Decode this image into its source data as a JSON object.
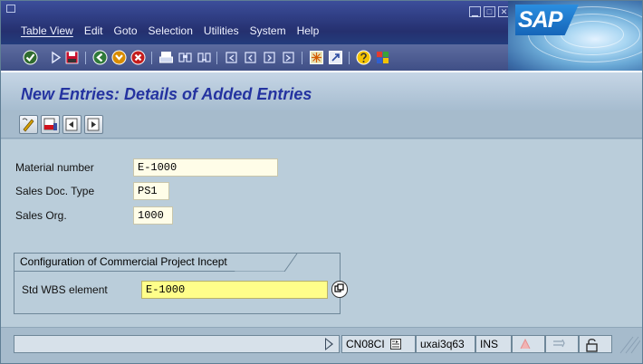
{
  "menu": {
    "items": [
      "Table View",
      "Edit",
      "Goto",
      "Selection",
      "Utilities",
      "System",
      "Help"
    ]
  },
  "window_buttons": [
    "minimize-icon",
    "maximize-icon",
    "close-icon"
  ],
  "logo": {
    "text": "SAP"
  },
  "standard_toolbar": {
    "icons": [
      "enter-icon",
      "command-field-arrow-icon",
      "save-icon",
      "back-icon",
      "exit-icon",
      "cancel-icon",
      "print-icon",
      "find-icon",
      "find-next-icon",
      "first-page-icon",
      "previous-page-icon",
      "next-page-icon",
      "last-page-icon",
      "create-session-icon",
      "shortcut-icon",
      "help-icon",
      "customize-layout-icon"
    ]
  },
  "title": "New Entries: Details of Added Entries",
  "app_toolbar": {
    "icons": [
      "change-display-icon",
      "delete-icon",
      "previous-entry-icon",
      "next-entry-icon"
    ]
  },
  "fields": {
    "material_number": {
      "label": "Material number",
      "value": "E-1000"
    },
    "sales_doc_type": {
      "label": "Sales Doc. Type",
      "value": "PS1"
    },
    "sales_org": {
      "label": "Sales Org.",
      "value": "1000"
    }
  },
  "group": {
    "title": "Configuration of Commercial Project Incept",
    "std_wbs": {
      "label": "Std WBS element",
      "value": "E-1000"
    }
  },
  "status_bar": {
    "transaction": "CN08CI",
    "server": "uxai3q63",
    "mode": "INS"
  },
  "colors": {
    "title_text": "#2433a0",
    "input_bg": "#fffde8",
    "highlight_bg": "#fffe8a",
    "screen_bg": "#bacdda"
  }
}
